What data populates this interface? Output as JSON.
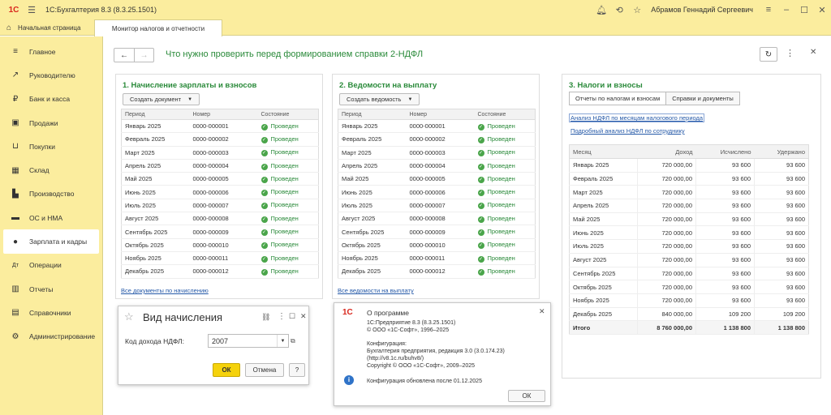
{
  "app": {
    "title": "1С:Бухгалтерия 8.3  (8.3.25.1501)",
    "user": "Абрамов Геннадий Сергеевич",
    "logo": "1С"
  },
  "tabs": {
    "home": "Начальная страница",
    "active": "Монитор налогов и отчетности"
  },
  "sidebar": {
    "items": [
      {
        "label": "Главное",
        "icon": "menu-icon"
      },
      {
        "label": "Руководителю",
        "icon": "trend-icon"
      },
      {
        "label": "Банк и касса",
        "icon": "coin-icon"
      },
      {
        "label": "Продажи",
        "icon": "bag-icon"
      },
      {
        "label": "Покупки",
        "icon": "cart-icon"
      },
      {
        "label": "Склад",
        "icon": "warehouse-icon"
      },
      {
        "label": "Производство",
        "icon": "factory-icon"
      },
      {
        "label": "ОС и НМА",
        "icon": "truck-icon"
      },
      {
        "label": "Зарплата и кадры",
        "icon": "person-icon"
      },
      {
        "label": "Операции",
        "icon": "debit-credit-icon"
      },
      {
        "label": "Отчеты",
        "icon": "bar-chart-icon"
      },
      {
        "label": "Справочники",
        "icon": "books-icon"
      },
      {
        "label": "Администрирование",
        "icon": "gear-icon"
      }
    ]
  },
  "page": {
    "title": "Что нужно проверить перед формированием справки 2-НДФЛ"
  },
  "accruals": {
    "title": "1. Начисление зарплаты и взносов",
    "button": "Создать документ",
    "columns": [
      "Период",
      "Номер",
      "Состояние"
    ],
    "rows": [
      [
        "Январь 2025",
        "0000-000001",
        "Проведен"
      ],
      [
        "Февраль 2025",
        "0000-000002",
        "Проведен"
      ],
      [
        "Март 2025",
        "0000-000003",
        "Проведен"
      ],
      [
        "Апрель 2025",
        "0000-000004",
        "Проведен"
      ],
      [
        "Май 2025",
        "0000-000005",
        "Проведен"
      ],
      [
        "Июнь 2025",
        "0000-000006",
        "Проведен"
      ],
      [
        "Июль 2025",
        "0000-000007",
        "Проведен"
      ],
      [
        "Август 2025",
        "0000-000008",
        "Проведен"
      ],
      [
        "Сентябрь 2025",
        "0000-000009",
        "Проведен"
      ],
      [
        "Октябрь 2025",
        "0000-000010",
        "Проведен"
      ],
      [
        "Ноябрь 2025",
        "0000-000011",
        "Проведен"
      ],
      [
        "Декабрь 2025",
        "0000-000012",
        "Проведен"
      ]
    ],
    "link": "Все документы по начислению"
  },
  "payroll": {
    "title": "2. Ведомости на выплату",
    "button": "Создать ведомость",
    "columns": [
      "Период",
      "Номер",
      "Состояние"
    ],
    "rows": [
      [
        "Январь 2025",
        "0000-000001",
        "Проведен"
      ],
      [
        "Февраль 2025",
        "0000-000002",
        "Проведен"
      ],
      [
        "Март 2025",
        "0000-000003",
        "Проведен"
      ],
      [
        "Апрель 2025",
        "0000-000004",
        "Проведен"
      ],
      [
        "Май 2025",
        "0000-000005",
        "Проведен"
      ],
      [
        "Июнь 2025",
        "0000-000006",
        "Проведен"
      ],
      [
        "Июль 2025",
        "0000-000007",
        "Проведен"
      ],
      [
        "Август 2025",
        "0000-000008",
        "Проведен"
      ],
      [
        "Сентябрь 2025",
        "0000-000009",
        "Проведен"
      ],
      [
        "Октябрь 2025",
        "0000-000010",
        "Проведен"
      ],
      [
        "Ноябрь 2025",
        "0000-000011",
        "Проведен"
      ],
      [
        "Декабрь 2025",
        "0000-000012",
        "Проведен"
      ]
    ],
    "link": "Все ведомости на выплату"
  },
  "taxes": {
    "title": "3. Налоги и взносы",
    "seg": [
      "Отчеты по налогам и взносам",
      "Справки и документы"
    ],
    "link1": "Анализ НДФЛ по месяцам налогового периода",
    "link2": "Подробный анализ НДФЛ по сотруднику",
    "columns": [
      "Месяц",
      "Доход",
      "Исчислено",
      "Удержано"
    ],
    "rows": [
      [
        "Январь 2025",
        "720 000,00",
        "93 600",
        "93 600"
      ],
      [
        "Февраль 2025",
        "720 000,00",
        "93 600",
        "93 600"
      ],
      [
        "Март 2025",
        "720 000,00",
        "93 600",
        "93 600"
      ],
      [
        "Апрель 2025",
        "720 000,00",
        "93 600",
        "93 600"
      ],
      [
        "Май 2025",
        "720 000,00",
        "93 600",
        "93 600"
      ],
      [
        "Июнь 2025",
        "720 000,00",
        "93 600",
        "93 600"
      ],
      [
        "Июль 2025",
        "720 000,00",
        "93 600",
        "93 600"
      ],
      [
        "Август 2025",
        "720 000,00",
        "93 600",
        "93 600"
      ],
      [
        "Сентябрь 2025",
        "720 000,00",
        "93 600",
        "93 600"
      ],
      [
        "Октябрь 2025",
        "720 000,00",
        "93 600",
        "93 600"
      ],
      [
        "Ноябрь 2025",
        "720 000,00",
        "93 600",
        "93 600"
      ],
      [
        "Декабрь 2025",
        "840 000,00",
        "109 200",
        "109 200"
      ]
    ],
    "total": [
      "Итого",
      "8 760 000,00",
      "1 138 800",
      "1 138 800"
    ]
  },
  "accrual_dialog": {
    "title": "Вид начисления",
    "field_label": "Код дохода НДФЛ:",
    "field_value": "2007",
    "ok": "ОК",
    "cancel": "Отмена",
    "help": "?"
  },
  "about": {
    "title": "О программе",
    "line1": "1С:Предприятие 8.3 (8.3.25.1501)",
    "line2": "© ООО «1С-Софт», 1996–2025",
    "line3": "Конфигурация:",
    "line4": "Бухгалтерия предприятия, редакция 3.0 (3.0.174.23)",
    "line5": "(http://v8.1c.ru/buhv8/)",
    "line6": "Copyright © ООО «1С-Софт», 2009–2025",
    "line7": "Конфигурация обновлена после 01.12.2025",
    "ok": "ОК"
  }
}
